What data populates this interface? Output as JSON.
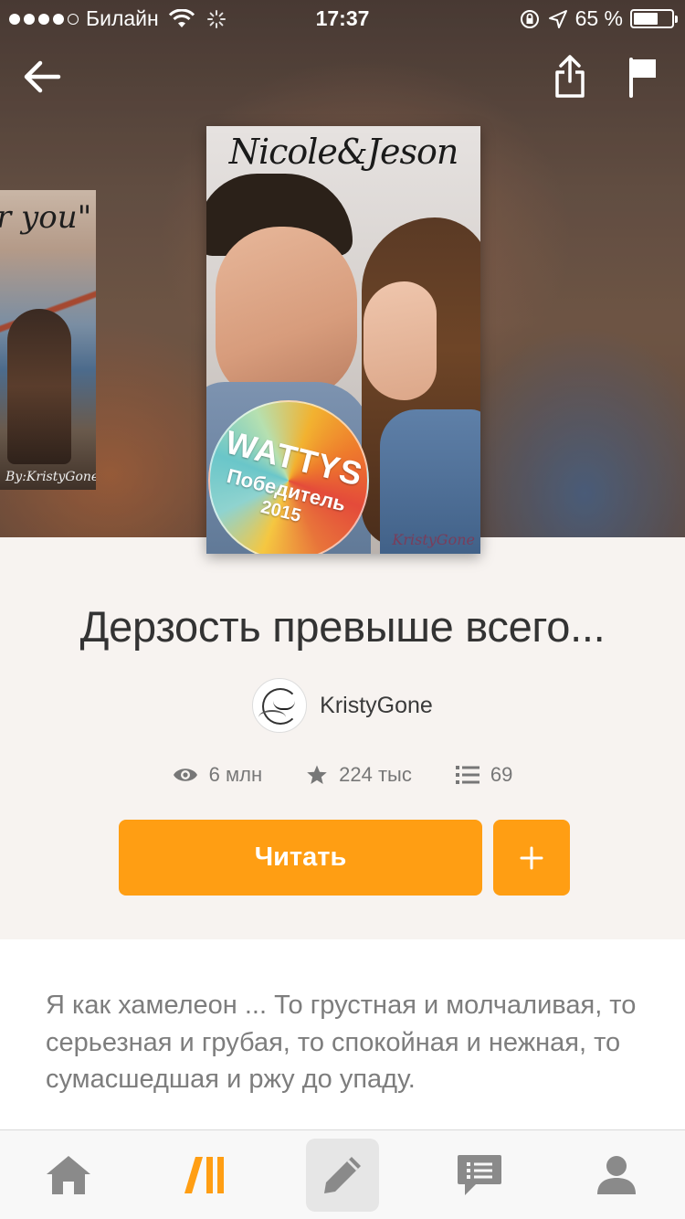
{
  "status_bar": {
    "carrier": "Билайн",
    "time": "17:37",
    "battery": "65 %",
    "battery_level": 0.65
  },
  "header": {
    "back_icon": "arrow-left-icon",
    "share_icon": "share-icon",
    "report_icon": "flag-icon"
  },
  "covers": {
    "side_cover_text": "r you\"",
    "side_cover_byline": "By:KristyGone",
    "main_cover_title": "Nicole&Jeson",
    "badge_line1": "WATTYS",
    "badge_line2": "Победитель",
    "badge_line3": "2015",
    "main_cover_signature": "KristyGone"
  },
  "book": {
    "title": "Дерзость превыше всего...",
    "author": "KristyGone",
    "stats": {
      "reads": "6 млн",
      "votes": "224 тыс",
      "parts": "69"
    },
    "read_button": "Читать",
    "add_button": "+",
    "description": "Я как хамелеон ... То грустная и молчаливая, то серьезная и грубая, то спокойная и нежная, то сумасшедшая и ржу до упаду."
  },
  "tabs": [
    {
      "name": "home",
      "icon": "home-icon"
    },
    {
      "name": "library",
      "icon": "library-icon"
    },
    {
      "name": "write",
      "icon": "pencil-icon"
    },
    {
      "name": "messages",
      "icon": "chat-icon"
    },
    {
      "name": "profile",
      "icon": "person-icon"
    }
  ],
  "colors": {
    "accent": "#ff9e13",
    "background": "#f7f3f0",
    "tab_inactive": "#8a8a8a"
  }
}
